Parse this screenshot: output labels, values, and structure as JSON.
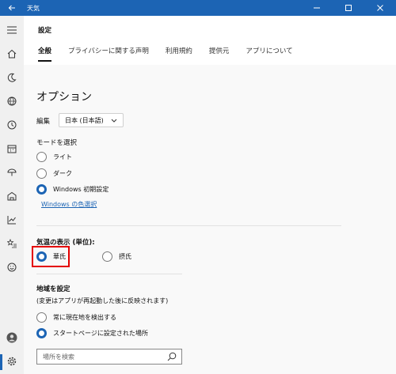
{
  "titlebar": {
    "app_title": "天気",
    "back_icon": "back-arrow-icon"
  },
  "page": {
    "title": "設定"
  },
  "tabs": [
    {
      "label": "全般",
      "active": true
    },
    {
      "label": "プライバシーに関する声明",
      "active": false
    },
    {
      "label": "利用規約",
      "active": false
    },
    {
      "label": "提供元",
      "active": false
    },
    {
      "label": "アプリについて",
      "active": false
    }
  ],
  "options": {
    "heading": "オプション",
    "edition_label": "編集",
    "edition_value": "日本 (日本語)",
    "mode_label": "モードを選択",
    "mode_options": [
      "ライト",
      "ダーク",
      "Windows 初期設定"
    ],
    "mode_selected": "Windows 初期設定",
    "color_link": "Windows の色選択",
    "temp_label": "気温の表示 (単位):",
    "temp_options": [
      "華氏",
      "摂氏"
    ],
    "temp_selected": "華氏",
    "region_label": "地域を設定",
    "region_note": "(変更はアプリが再起動した後に反映されます)",
    "region_options": [
      "常に現在地を検出する",
      "スタートページに設定された場所"
    ],
    "region_selected": "スタートページに設定された場所",
    "search_placeholder": "場所を検索"
  },
  "colors": {
    "accent": "#1c64b4",
    "highlight": "#e40000"
  }
}
